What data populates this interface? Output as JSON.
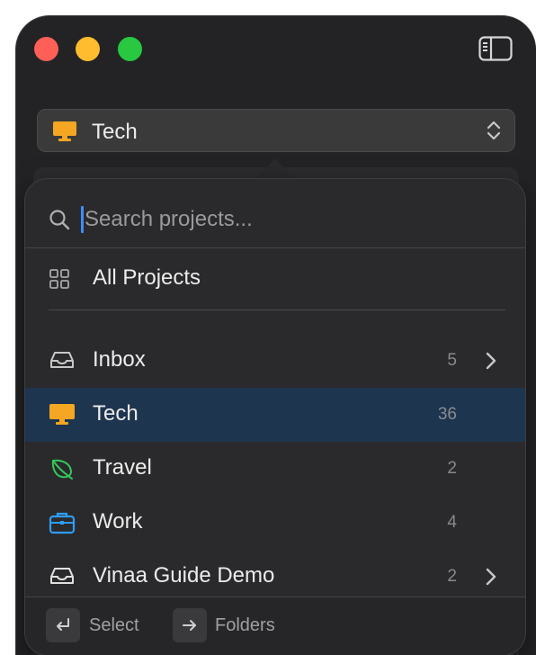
{
  "window": {
    "title": ""
  },
  "picker": {
    "icon": "monitor-icon",
    "label": "Tech"
  },
  "search": {
    "placeholder": "Search projects...",
    "value": ""
  },
  "all_projects": {
    "icon": "grid-icon",
    "label": "All Projects"
  },
  "projects": [
    {
      "icon": "inbox-tray-icon",
      "label": "Inbox",
      "count": "5",
      "has_chevron": true,
      "selected": false,
      "color": "#c7c7c7"
    },
    {
      "icon": "monitor-icon",
      "label": "Tech",
      "count": "36",
      "has_chevron": false,
      "selected": true,
      "color": "#f5a623"
    },
    {
      "icon": "leaf-icon",
      "label": "Travel",
      "count": "2",
      "has_chevron": false,
      "selected": false,
      "color": "#34c759"
    },
    {
      "icon": "briefcase-icon",
      "label": "Work",
      "count": "4",
      "has_chevron": false,
      "selected": false,
      "color": "#2f9df4"
    },
    {
      "icon": "inbox-tray-icon",
      "label": "Vinaa Guide Demo",
      "count": "2",
      "has_chevron": true,
      "selected": false,
      "color": "#e0e0e0"
    }
  ],
  "footer": {
    "select": {
      "icon": "return-key-icon",
      "label": "Select"
    },
    "folders": {
      "icon": "right-arrow-key-icon",
      "label": "Folders"
    }
  },
  "colors": {
    "selected_row": "#1e3550",
    "caret": "#3d8cff",
    "tech_orange": "#f5a623"
  }
}
